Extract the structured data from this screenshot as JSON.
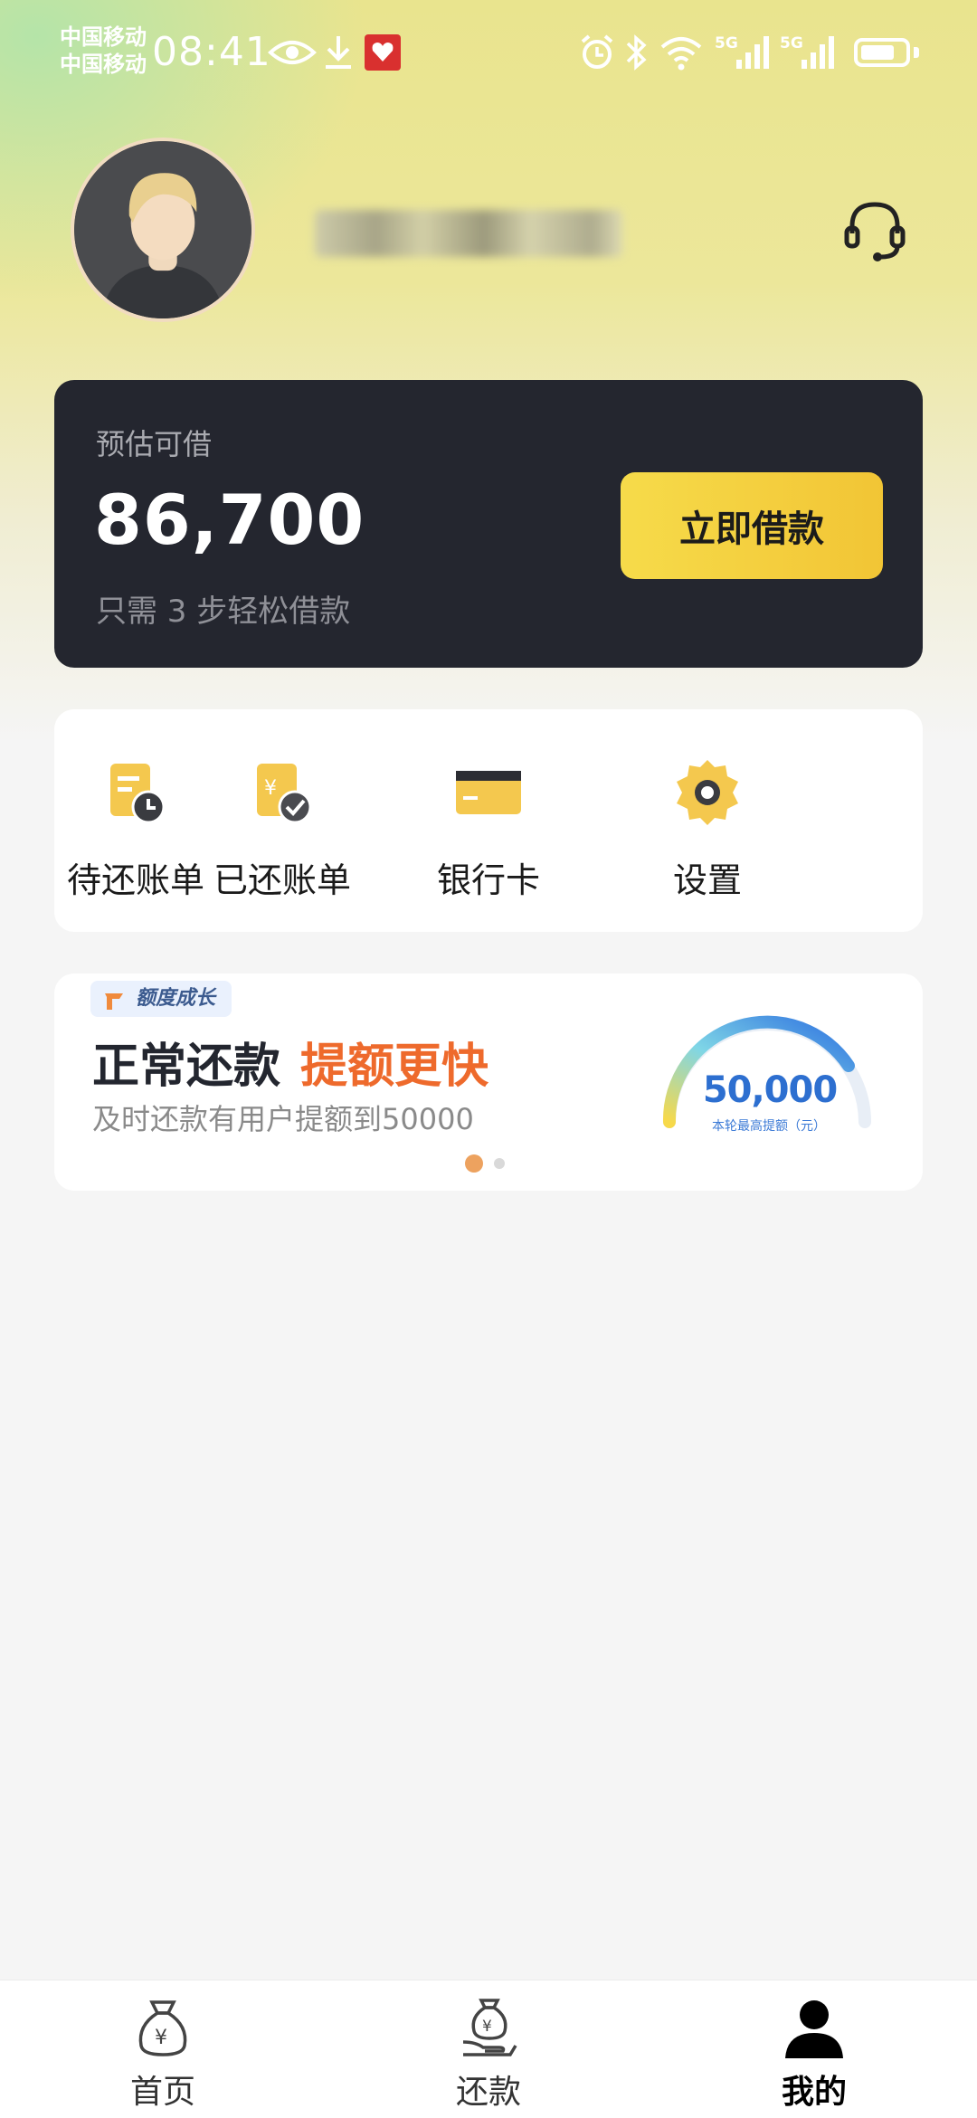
{
  "status_bar": {
    "carrier1": "中国移动",
    "carrier2": "中国移动",
    "time": "08:41",
    "signal_label_1": "5G",
    "signal_label_2": "5G"
  },
  "loan_card": {
    "label": "预估可借",
    "amount": "86,700",
    "subtext": "只需 3 步轻松借款",
    "button_label": "立即借款"
  },
  "quick_actions": [
    {
      "label": "待还账单",
      "icon": "pending-bill-icon"
    },
    {
      "label": "已还账单",
      "icon": "paid-bill-icon"
    },
    {
      "label": "银行卡",
      "icon": "bank-card-icon"
    },
    {
      "label": "设置",
      "icon": "gear-icon"
    }
  ],
  "banner": {
    "tag": "额度成长",
    "title_main": "正常还款",
    "title_highlight": "提额更快",
    "subtitle": "及时还款有用户提额到50000",
    "gauge_value": "50,000",
    "gauge_caption": "本轮最高提额（元）",
    "slides_total": 2,
    "slide_active": 1
  },
  "bottom_nav": [
    {
      "label": "首页",
      "icon": "money-bag-icon"
    },
    {
      "label": "还款",
      "icon": "repay-hand-icon"
    },
    {
      "label": "我的",
      "icon": "user-icon",
      "active": true
    }
  ],
  "colors": {
    "card_dark": "#24262f",
    "accent_yellow": "#f2c535",
    "highlight_orange": "#ee6a2c",
    "gauge_blue": "#2d6fd0"
  }
}
